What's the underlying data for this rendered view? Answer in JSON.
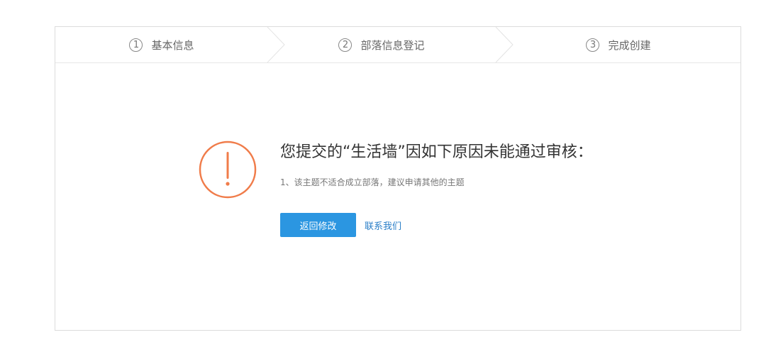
{
  "steps": [
    {
      "num": "1",
      "label": "基本信息"
    },
    {
      "num": "2",
      "label": "部落信息登记"
    },
    {
      "num": "3",
      "label": "完成创建"
    }
  ],
  "icons": {
    "warning": "exclamation-circle-icon"
  },
  "colors": {
    "warning": "#f07c4a",
    "primary_button": "#2b96e1",
    "link": "#2b7fc8"
  },
  "message": {
    "title": "您提交的“生活墙”因如下原因未能通过审核：",
    "reason": "1、该主题不适合成立部落，建议申请其他的主题"
  },
  "actions": {
    "back_label": "返回修改",
    "contact_label": "联系我们"
  }
}
